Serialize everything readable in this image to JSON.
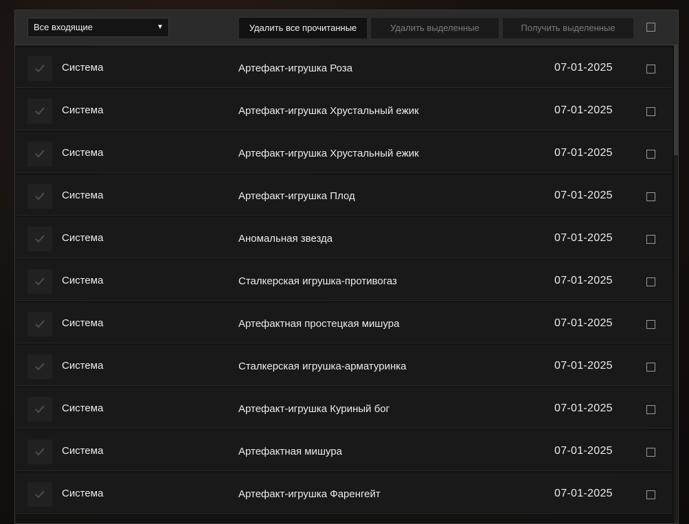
{
  "toolbar": {
    "filter_value": "Все входящие",
    "delete_read_label": "Удалить все прочитанные",
    "delete_selected_label": "Удалить выделенные",
    "receive_selected_label": "Получить выделенные"
  },
  "messages": [
    {
      "sender": "Система",
      "subject": "Артефакт-игрушка Роза",
      "date": "07-01-2025"
    },
    {
      "sender": "Система",
      "subject": "Артефакт-игрушка Хрустальный ежик",
      "date": "07-01-2025"
    },
    {
      "sender": "Система",
      "subject": "Артефакт-игрушка Хрустальный ежик",
      "date": "07-01-2025"
    },
    {
      "sender": "Система",
      "subject": "Артефакт-игрушка Плод",
      "date": "07-01-2025"
    },
    {
      "sender": "Система",
      "subject": "Аномальная звезда",
      "date": "07-01-2025"
    },
    {
      "sender": "Система",
      "subject": "Сталкерская игрушка-противогаз",
      "date": "07-01-2025"
    },
    {
      "sender": "Система",
      "subject": "Артефактная простецкая мишура",
      "date": "07-01-2025"
    },
    {
      "sender": "Система",
      "subject": "Сталкерская игрушка-арматуринка",
      "date": "07-01-2025"
    },
    {
      "sender": "Система",
      "subject": "Артефакт-игрушка Куриный бог",
      "date": "07-01-2025"
    },
    {
      "sender": "Система",
      "subject": "Артефактная мишура",
      "date": "07-01-2025"
    },
    {
      "sender": "Система",
      "subject": "Артефакт-игрушка Фаренгейт",
      "date": "07-01-2025"
    }
  ]
}
